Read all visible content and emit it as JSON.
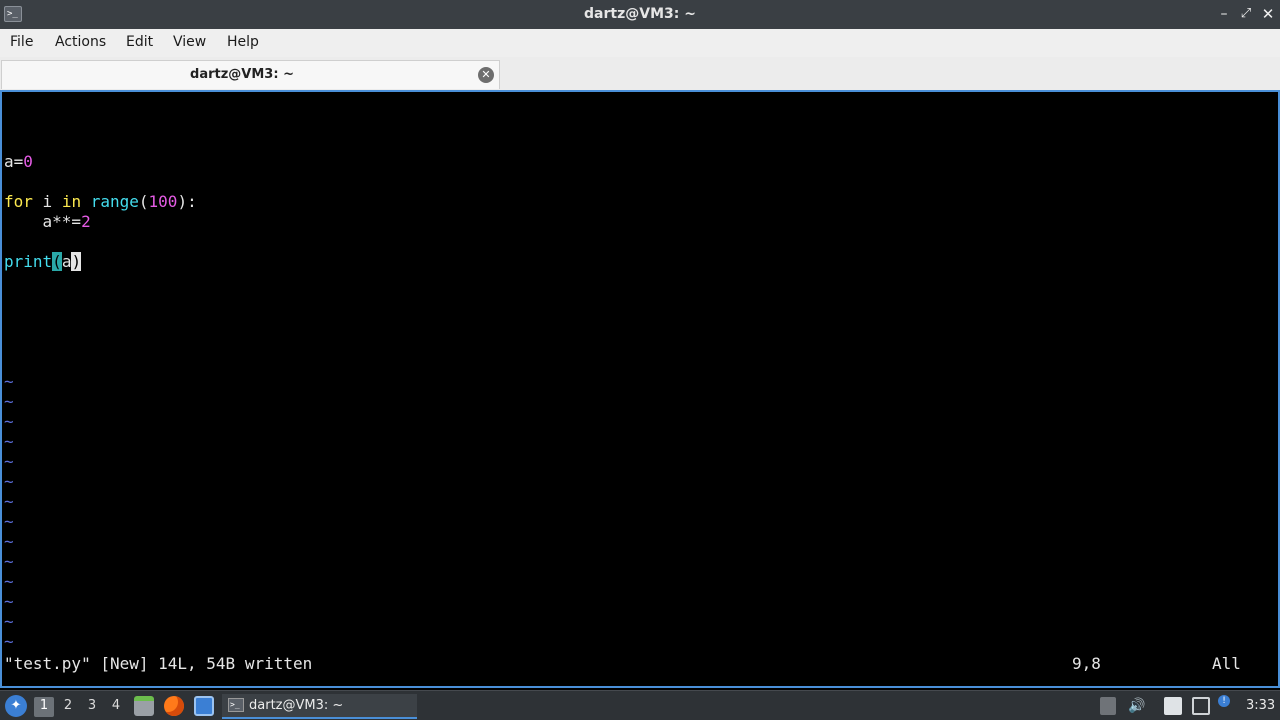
{
  "window": {
    "title": "dartz@VM3: ~",
    "app_icon_glyph": ">_",
    "buttons": {
      "minimize": "–",
      "maximize": "⤢",
      "close": "✕"
    }
  },
  "menu": [
    "File",
    "Actions",
    "Edit",
    "View",
    "Help"
  ],
  "tab": {
    "label": "dartz@VM3: ~",
    "close_glyph": "✕"
  },
  "editor": {
    "code": {
      "line_a0_var": "a=",
      "line_a0_num": "0",
      "for_kw": "for",
      "for_var": " i ",
      "in_kw": "in",
      "range_fn": "range",
      "range_open": "(",
      "range_num": "100",
      "range_close": "):",
      "aug_text": "    a**=",
      "aug_num": "2",
      "print_fn": "print",
      "print_open": "(",
      "print_arg": "a",
      "print_close": ")"
    },
    "tilde": "~",
    "status_message": "\"test.py\" [New] 14L, 54B written",
    "cursor_position": "9,8",
    "scroll_position": "All"
  },
  "taskbar": {
    "start_glyph": "✦",
    "desktops": [
      "1",
      "2",
      "3",
      "4"
    ],
    "active_desktop": "1",
    "task_label": "dartz@VM3: ~",
    "task_icon_glyph": ">_",
    "volume_glyph": "🔊",
    "notification_glyph": "!",
    "clock": "3:33"
  },
  "colors": {
    "keyword": "#fce94f",
    "number": "#e55ce5",
    "function": "#44ddee",
    "tilde": "#5c6fdc",
    "accent": "#4a8fd8"
  }
}
